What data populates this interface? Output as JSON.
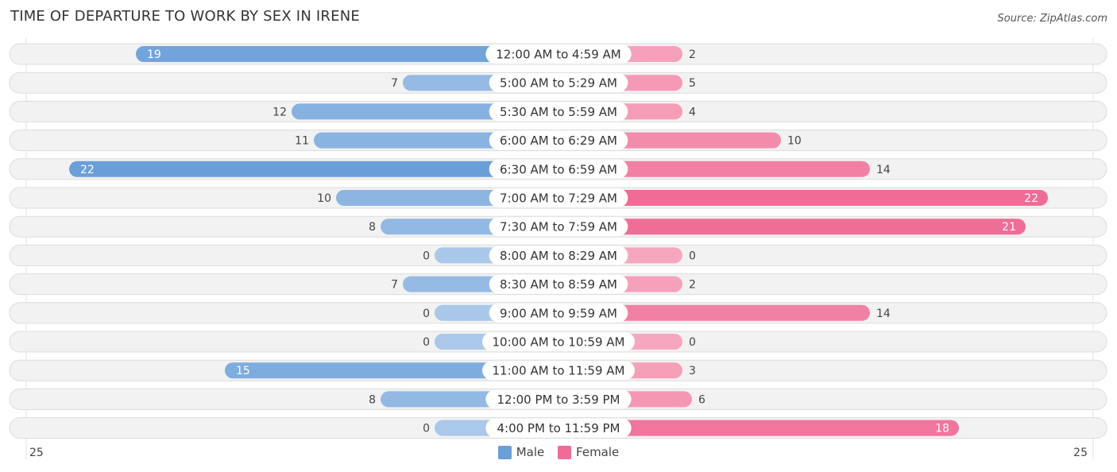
{
  "title": "TIME OF DEPARTURE TO WORK BY SEX IN IRENE",
  "source": "Source: ZipAtlas.com",
  "colors": {
    "male": "#6a9fd9",
    "male_light": "#a9c8ea",
    "female": "#f06b96",
    "female_light": "#f6a7bf",
    "row_bg": "#f2f2f2",
    "row_border": "#dcdcdc"
  },
  "chart_data": {
    "type": "bar",
    "orientation": "horizontal-diverging",
    "title": "TIME OF DEPARTURE TO WORK BY SEX IN IRENE",
    "categories": [
      "12:00 AM to 4:59 AM",
      "5:00 AM to 5:29 AM",
      "5:30 AM to 5:59 AM",
      "6:00 AM to 6:29 AM",
      "6:30 AM to 6:59 AM",
      "7:00 AM to 7:29 AM",
      "7:30 AM to 7:59 AM",
      "8:00 AM to 8:29 AM",
      "8:30 AM to 8:59 AM",
      "9:00 AM to 9:59 AM",
      "10:00 AM to 10:59 AM",
      "11:00 AM to 11:59 AM",
      "12:00 PM to 3:59 PM",
      "4:00 PM to 11:59 PM"
    ],
    "series": [
      {
        "name": "Male",
        "values": [
          19,
          7,
          12,
          11,
          22,
          10,
          8,
          0,
          7,
          0,
          0,
          15,
          8,
          0
        ]
      },
      {
        "name": "Female",
        "values": [
          2,
          5,
          4,
          10,
          14,
          22,
          21,
          0,
          2,
          14,
          0,
          3,
          6,
          18
        ]
      }
    ],
    "xlim": [
      -25,
      25
    ],
    "axis_tick_labels": {
      "left": "25",
      "right": "25"
    },
    "legend": {
      "position": "bottom-center",
      "entries": [
        "Male",
        "Female"
      ]
    },
    "grid": false
  }
}
